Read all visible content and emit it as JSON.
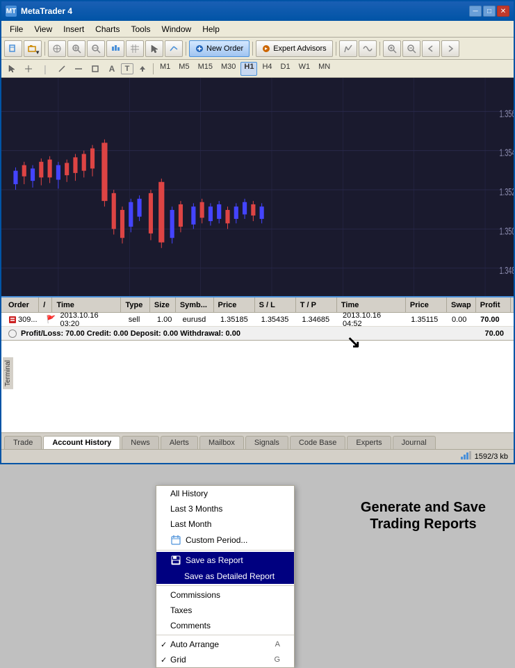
{
  "window": {
    "title": "MetaTrader 4",
    "icon": "MT"
  },
  "titlebar_controls": {
    "minimize": "─",
    "restore": "□",
    "close": "✕"
  },
  "menubar": {
    "items": [
      "File",
      "View",
      "Insert",
      "Charts",
      "Tools",
      "Window",
      "Help"
    ]
  },
  "toolbar": {
    "new_order_label": "New Order",
    "expert_advisors_label": "Expert Advisors"
  },
  "timeframes": {
    "items": [
      "M1",
      "M5",
      "M15",
      "M30",
      "H1",
      "H4",
      "D1",
      "W1",
      "MN"
    ],
    "active": "H1"
  },
  "table": {
    "headers": [
      "Order",
      "/",
      "Time",
      "Type",
      "Size",
      "Symb...",
      "Price",
      "S / L",
      "T / P",
      "Time",
      "Price",
      "Swap",
      "Profit"
    ],
    "rows": [
      {
        "order": "309...",
        "flag": "🚩",
        "time": "2013.10.16 03:20",
        "type": "sell",
        "size": "1.00",
        "symbol": "eurusd",
        "price": "1.35185",
        "sl": "1.35435",
        "tp": "1.34685",
        "close_time": "2013.10.16 04:52",
        "close_price": "1.35115",
        "swap": "0.00",
        "profit": "70.00"
      }
    ],
    "summary": "Profit/Loss: 70.00  Credit: 0.00  Deposit: 0.00  Withdrawal: 0.00",
    "summary_value": "70.00"
  },
  "context_menu": {
    "items": [
      {
        "id": "all-history",
        "label": "All History",
        "type": "normal"
      },
      {
        "id": "last-3-months",
        "label": "Last 3 Months",
        "type": "normal"
      },
      {
        "id": "last-month",
        "label": "Last Month",
        "type": "normal"
      },
      {
        "id": "custom-period",
        "label": "Custom Period...",
        "type": "normal",
        "has_icon": true
      },
      {
        "id": "separator1",
        "type": "separator"
      },
      {
        "id": "save-report",
        "label": "Save as Report",
        "type": "highlighted",
        "has_icon": true
      },
      {
        "id": "save-detailed",
        "label": "Save as Detailed Report",
        "type": "highlighted"
      },
      {
        "id": "separator2",
        "type": "separator"
      },
      {
        "id": "commissions",
        "label": "Commissions",
        "type": "normal"
      },
      {
        "id": "taxes",
        "label": "Taxes",
        "type": "normal"
      },
      {
        "id": "comments",
        "label": "Comments",
        "type": "normal"
      },
      {
        "id": "separator3",
        "type": "separator"
      },
      {
        "id": "auto-arrange",
        "label": "Auto Arrange",
        "shortcut": "A",
        "type": "checked"
      },
      {
        "id": "grid",
        "label": "Grid",
        "shortcut": "G",
        "type": "checked"
      }
    ]
  },
  "annotation": {
    "line1": "Generate and Save",
    "line2": "Trading Reports"
  },
  "tabs": {
    "items": [
      "Trade",
      "Account History",
      "News",
      "Alerts",
      "Mailbox",
      "Signals",
      "Code Base",
      "Experts",
      "Journal"
    ],
    "active": "Account History"
  },
  "statusbar": {
    "memory": "1592/3 kb"
  }
}
